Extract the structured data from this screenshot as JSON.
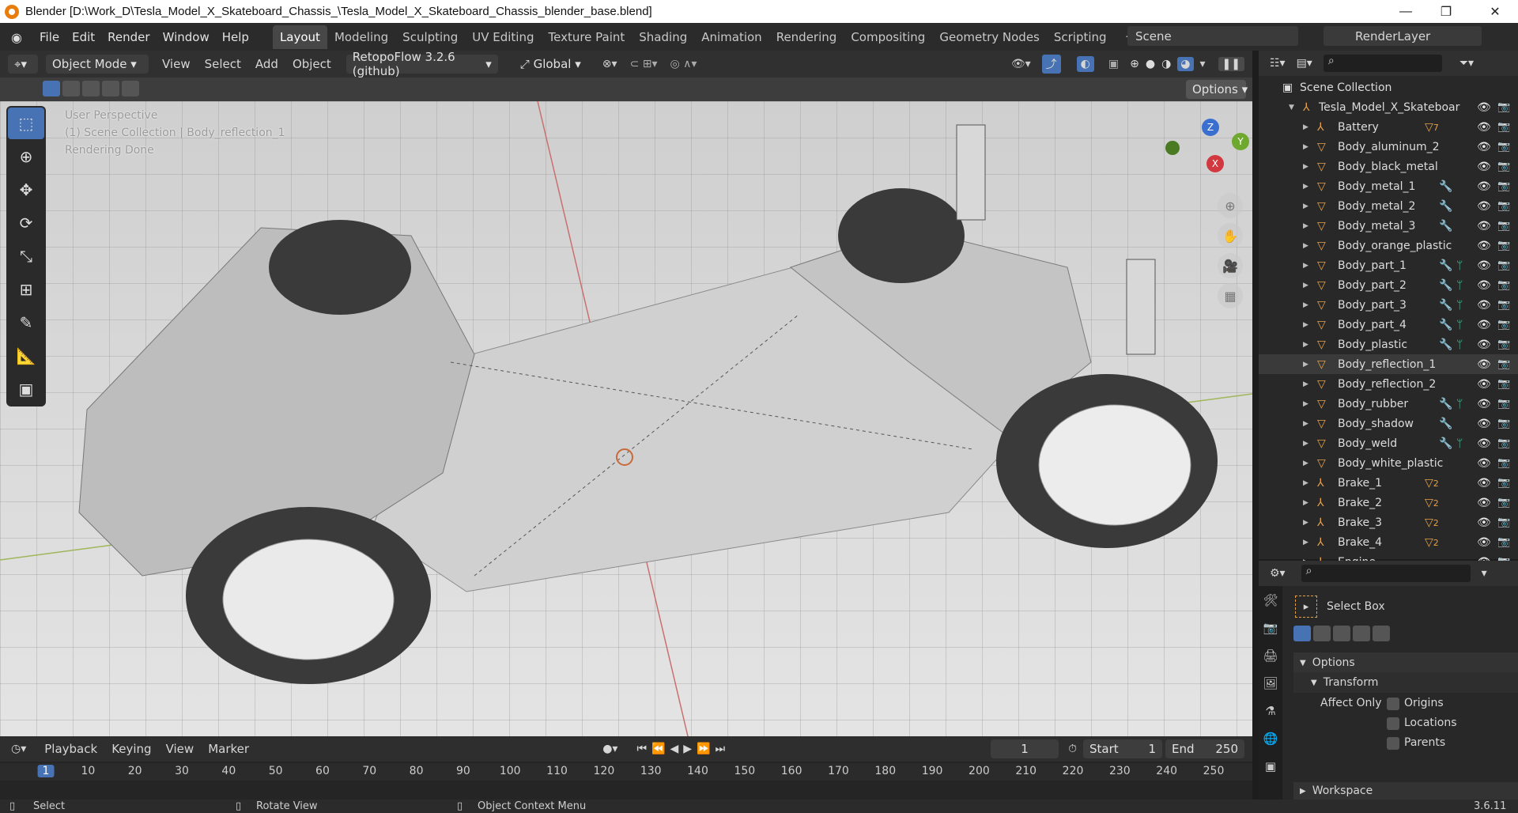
{
  "window": {
    "title": "Blender [D:\\Work_D\\Tesla_Model_X_Skateboard_Chassis_\\Tesla_Model_X_Skateboard_Chassis_blender_base.blend]",
    "minimize": "—",
    "maximize": "❐",
    "close": "✕"
  },
  "menu": [
    "File",
    "Edit",
    "Render",
    "Window",
    "Help"
  ],
  "workspaces": [
    "Layout",
    "Modeling",
    "Sculpting",
    "UV Editing",
    "Texture Paint",
    "Shading",
    "Animation",
    "Rendering",
    "Compositing",
    "Geometry Nodes",
    "Scripting"
  ],
  "active_workspace": "Layout",
  "scene": "Scene",
  "render_layer": "RenderLayer",
  "viewport_header": {
    "mode": "Object Mode",
    "menus": [
      "View",
      "Select",
      "Add",
      "Object"
    ],
    "addon": "RetopoFlow 3.2.6 (github)",
    "orientation": "Global",
    "options": "Options"
  },
  "viewport_overlay": {
    "line1": "User Perspective",
    "line2": "(1) Scene Collection | Body_reflection_1",
    "line3": "Rendering Done"
  },
  "gizmo": {
    "z": "Z",
    "y": "Y",
    "x": "X"
  },
  "outliner": {
    "root": "Scene Collection",
    "collection": "Tesla_Model_X_Skateboar",
    "items": [
      {
        "name": "Battery",
        "badge": "7",
        "type": "empty"
      },
      {
        "name": "Body_aluminum_2",
        "type": "mesh"
      },
      {
        "name": "Body_black_metal",
        "type": "mesh"
      },
      {
        "name": "Body_metal_1",
        "type": "mesh",
        "mod": true
      },
      {
        "name": "Body_metal_2",
        "type": "mesh",
        "mod": true
      },
      {
        "name": "Body_metal_3",
        "type": "mesh",
        "mod": true
      },
      {
        "name": "Body_orange_plastic",
        "type": "mesh"
      },
      {
        "name": "Body_part_1",
        "type": "mesh",
        "mod": true,
        "vg": true
      },
      {
        "name": "Body_part_2",
        "type": "mesh",
        "mod": true,
        "vg": true
      },
      {
        "name": "Body_part_3",
        "type": "mesh",
        "mod": true,
        "vg": true
      },
      {
        "name": "Body_part_4",
        "type": "mesh",
        "mod": true,
        "vg": true
      },
      {
        "name": "Body_plastic",
        "type": "mesh",
        "mod": true,
        "vg": true
      },
      {
        "name": "Body_reflection_1",
        "type": "mesh",
        "active": true
      },
      {
        "name": "Body_reflection_2",
        "type": "mesh"
      },
      {
        "name": "Body_rubber",
        "type": "mesh",
        "mod": true,
        "vg": true
      },
      {
        "name": "Body_shadow",
        "type": "mesh",
        "mod": true
      },
      {
        "name": "Body_weld",
        "type": "mesh",
        "mod": true,
        "vg": true
      },
      {
        "name": "Body_white_plastic",
        "type": "mesh"
      },
      {
        "name": "Brake_1",
        "badge": "2",
        "type": "empty"
      },
      {
        "name": "Brake_2",
        "badge": "2",
        "type": "empty"
      },
      {
        "name": "Brake_3",
        "badge": "2",
        "type": "empty"
      },
      {
        "name": "Brake_4",
        "badge": "2",
        "type": "empty"
      },
      {
        "name": "Engine",
        "type": "empty"
      }
    ]
  },
  "properties": {
    "tool": "Select Box",
    "options": "Options",
    "transform": "Transform",
    "affect_only": "Affect Only",
    "checks": [
      "Origins",
      "Locations",
      "Parents"
    ],
    "workspace": "Workspace"
  },
  "timeline": {
    "menus": [
      "Playback",
      "Keying",
      "View",
      "Marker"
    ],
    "current_frame": "1",
    "start_label": "Start",
    "start": "1",
    "end_label": "End",
    "end": "250",
    "ticks": [
      "1",
      "10",
      "20",
      "30",
      "40",
      "50",
      "60",
      "70",
      "80",
      "90",
      "100",
      "110",
      "120",
      "130",
      "140",
      "150",
      "160",
      "170",
      "180",
      "190",
      "200",
      "210",
      "220",
      "230",
      "240",
      "250"
    ]
  },
  "statusbar": {
    "select": "Select",
    "rotate": "Rotate View",
    "context": "Object Context Menu",
    "version": "3.6.11"
  }
}
